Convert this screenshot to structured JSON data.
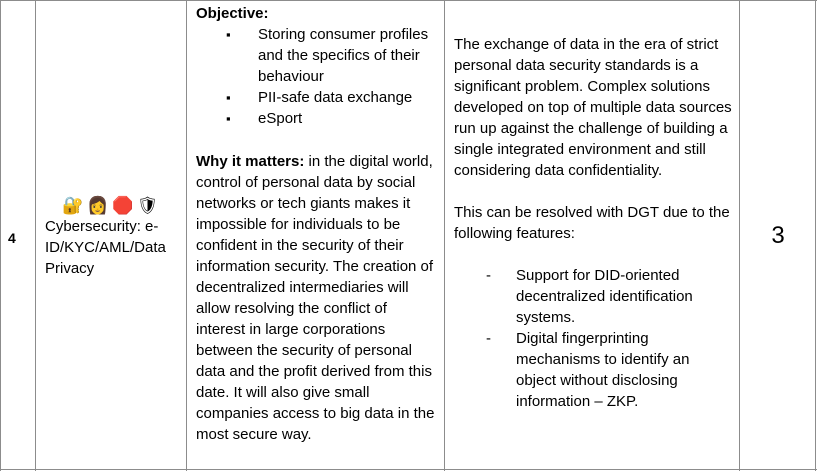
{
  "row": {
    "number": "4",
    "icons": [
      {
        "name": "lock-icon",
        "glyph": "🔐"
      },
      {
        "name": "person-icon",
        "glyph": "👩"
      },
      {
        "name": "stop-sign-icon",
        "glyph": "🛑"
      },
      {
        "name": "shield-icon",
        "glyph": "🛡"
      }
    ],
    "category": "Cybersecurity: e-ID/KYC/AML/Data Privacy",
    "objective": {
      "label": "Objective:",
      "items": [
        "Storing consumer profiles and the specifics of their behaviour",
        "PII-safe data exchange",
        "eSport"
      ]
    },
    "why": {
      "label": "Why it matters:",
      "text": " in the digital world, control of personal data by social networks or tech giants makes it impossible for individuals to be confident in the security of their information security. The creation of decentralized intermediaries will allow resolving the conflict of interest in large corporations between the security of personal data and the profit derived from this date. It will also give small companies access to big data in the most secure way."
    },
    "description": {
      "para1": "The exchange of data in the era of strict personal data security standards is a significant problem. Complex solutions developed on top of multiple data sources run up against the challenge of building a single integrated environment and still considering data confidentiality.",
      "para2": "This can be resolved with DGT due to the following features:",
      "features": [
        "Support for DID-oriented decentralized identification systems.",
        "Digital fingerprinting mechanisms to identify an object without disclosing information – ZKP."
      ]
    },
    "score": "3"
  }
}
